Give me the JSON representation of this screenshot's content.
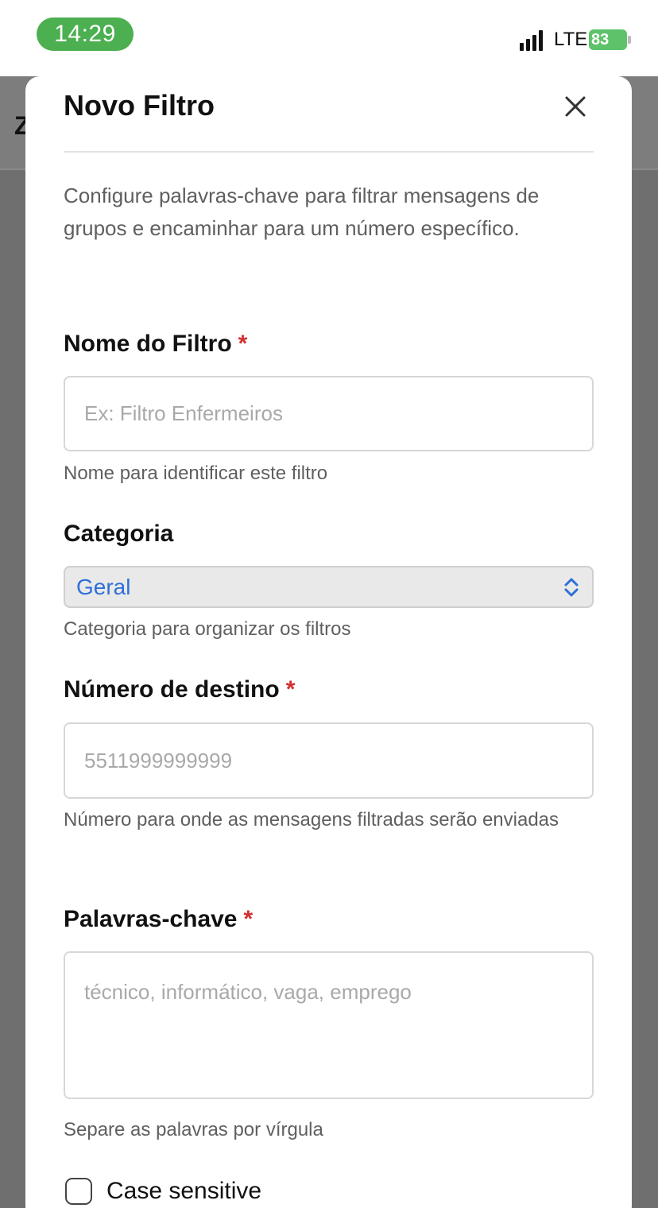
{
  "status_bar": {
    "time": "14:29",
    "network": "LTE",
    "battery": "83"
  },
  "background": {
    "header_letter": "Z"
  },
  "modal": {
    "title": "Novo Filtro",
    "description": "Configure palavras-chave para filtrar mensagens de grupos e encaminhar para um número específico."
  },
  "form": {
    "name": {
      "label": "Nome do Filtro",
      "required": "*",
      "placeholder": "Ex: Filtro Enfermeiros",
      "help": "Nome para identificar este filtro"
    },
    "category": {
      "label": "Categoria",
      "value": "Geral",
      "help": "Categoria para organizar os filtros"
    },
    "destination": {
      "label": "Número de destino",
      "required": "*",
      "placeholder": "5511999999999",
      "help": "Número para onde as mensagens filtradas serão enviadas"
    },
    "keywords": {
      "label": "Palavras-chave",
      "required": "*",
      "placeholder": "técnico, informático, vaga, emprego",
      "help": "Separe as palavras por vírgula"
    },
    "case_sensitive": {
      "label": "Case sensitive"
    }
  },
  "colors": {
    "time_pill": "#4caf50",
    "battery": "#5ec26a",
    "required": "#d32f2f",
    "select_value": "#2f6fd8"
  }
}
